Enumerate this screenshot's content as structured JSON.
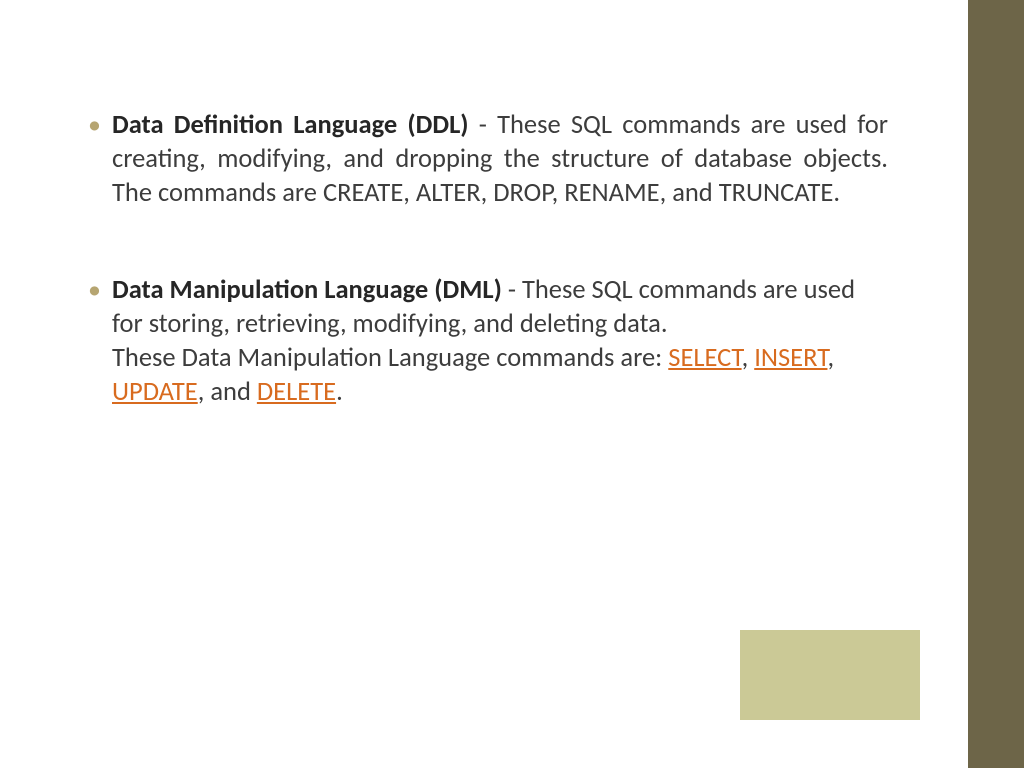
{
  "items": [
    {
      "title": "Data Definition Language (DDL)",
      "body": " - These SQL commands are used for creating, modifying, and dropping the structure of database objects. The commands are CREATE, ALTER, DROP, RENAME, and TRUNCATE."
    },
    {
      "title": "Data Manipulation Language (DML)",
      "body_pre": " - These SQL commands are used for storing, retrieving, modifying, and deleting data.",
      "body_cmd_intro": "These Data Manipulation Language commands are: ",
      "links": [
        "SELECT",
        "INSERT",
        "UPDATE",
        "DELETE"
      ],
      "separators": [
        ", ",
        ", ",
        ", and ",
        "."
      ]
    }
  ]
}
